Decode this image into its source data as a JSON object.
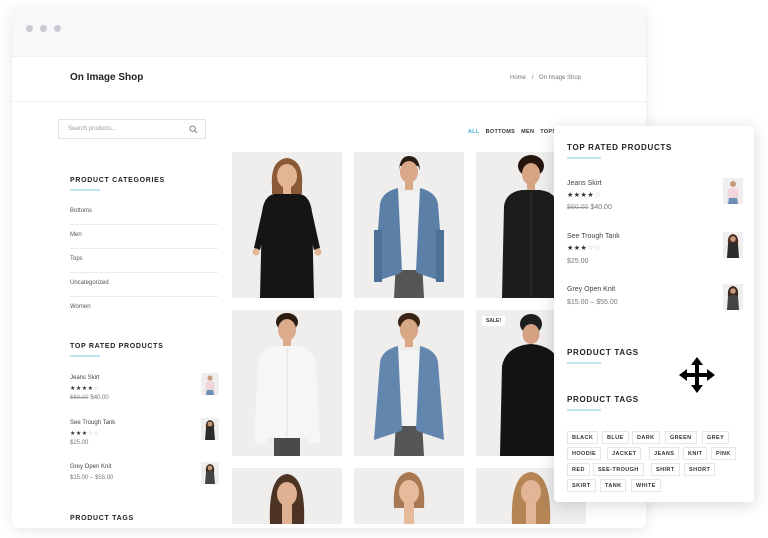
{
  "site": {
    "title": "On Image Shop"
  },
  "breadcrumb": [
    "Home",
    "/",
    "On Image Shop"
  ],
  "search": {
    "placeholder": "Search products..."
  },
  "sidebar": {
    "categories_heading": "PRODUCT CATEGORIES",
    "categories": [
      "Bottoms",
      "Men",
      "Tops",
      "Uncategorized",
      "Women"
    ],
    "top_rated_heading": "TOP RATED PRODUCTS",
    "top_rated": [
      {
        "name": "Jeans Skirt",
        "rating": 4,
        "old_price": "$60.00",
        "price": "$40.00"
      },
      {
        "name": "See Trough Tank",
        "rating": 3,
        "old_price": "",
        "price": "$25.00"
      },
      {
        "name": "Grey Open Knit",
        "rating": 0,
        "old_price": "",
        "price": "$15.00 – $55.00"
      }
    ],
    "tags_heading": "PRODUCT TAGS"
  },
  "filters": {
    "items": [
      "ALL",
      "BOTTOMS",
      "MEN",
      "TOPS"
    ],
    "active": "ALL"
  },
  "products": {
    "sale_badge": "SALE!"
  },
  "panel": {
    "top_rated_heading": "TOP RATED PRODUCTS",
    "top_rated": [
      {
        "name": "Jeans Skirt",
        "rating": 4,
        "old_price": "$60.00",
        "price": "$40.00"
      },
      {
        "name": "See Trough Tank",
        "rating": 3,
        "old_price": "",
        "price": "$25.00"
      },
      {
        "name": "Grey Open Knit",
        "rating": 0,
        "old_price": "",
        "price": "$15.00 – $55.00"
      }
    ],
    "tags_heading_1": "PRODUCT TAGS",
    "tags_heading_2": "PRODUCT TAGS",
    "tags": [
      [
        "BLACK",
        "BLUE",
        "DARK",
        "GREEN",
        "GREY"
      ],
      [
        "HOODIE",
        "JACKET",
        "JEANS",
        "KNIT",
        "PINK"
      ],
      [
        "RED",
        "SEE-TROUGH",
        "SHIRT",
        "SHORT"
      ],
      [
        "SKIRT",
        "TANK",
        "WHITE"
      ]
    ]
  },
  "colors": {
    "accent": "#3fb3d6",
    "accent_light": "#bfe4ef"
  },
  "icons": {
    "search": "search-icon",
    "move": "move-icon"
  }
}
